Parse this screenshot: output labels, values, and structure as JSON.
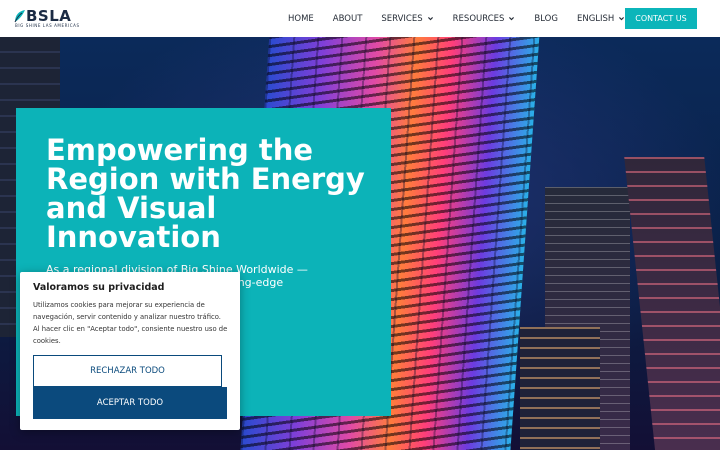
{
  "brand": {
    "logo_text": "BSLA",
    "logo_tagline": "BIG SHINE LAS AMERICAS",
    "accent_color": "#0bb5ba",
    "dark_blue": "#0b4a7d"
  },
  "nav": {
    "items": [
      {
        "label": "HOME",
        "has_dropdown": false
      },
      {
        "label": "ABOUT",
        "has_dropdown": false
      },
      {
        "label": "SERVICES",
        "has_dropdown": true
      },
      {
        "label": "RESOURCES",
        "has_dropdown": true
      },
      {
        "label": "BLOG",
        "has_dropdown": false
      },
      {
        "label": "ENGLISH",
        "has_dropdown": true
      }
    ],
    "contact_label": "CONTACT US"
  },
  "hero": {
    "title": "Empowering the Region with Energy and Visual Innovation",
    "text": "As a regional division of Big Shine Worldwide — a company that specializes in cutting-edge solutions to the"
  },
  "cookie": {
    "title": "Valoramos su privacidad",
    "text": "Utilizamos cookies para mejorar su experiencia de navegación, servir contenido y analizar nuestro tráfico. Al hacer clic en \"Aceptar todo\", consiente nuestro uso de cookies.",
    "reject_label": "RECHAZAR TODO",
    "accept_label": "ACEPTAR TODO"
  }
}
